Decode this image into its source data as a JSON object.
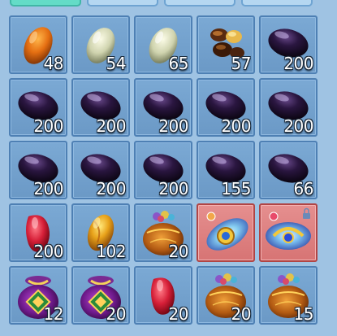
{
  "tabs": [
    {
      "active": true
    },
    {
      "active": false
    },
    {
      "active": false
    },
    {
      "active": false
    }
  ],
  "items": [
    {
      "icon": "orange-egg-icon",
      "qty": "48"
    },
    {
      "icon": "pale-egg-icon",
      "qty": "54"
    },
    {
      "icon": "pale-egg-icon",
      "qty": "65"
    },
    {
      "icon": "seed-pile-icon",
      "qty": "57"
    },
    {
      "icon": "dark-gem-icon",
      "qty": "200"
    },
    {
      "icon": "dark-gem-icon",
      "qty": "200"
    },
    {
      "icon": "dark-gem-icon",
      "qty": "200"
    },
    {
      "icon": "dark-gem-icon",
      "qty": "200"
    },
    {
      "icon": "dark-gem-icon",
      "qty": "200"
    },
    {
      "icon": "dark-gem-icon",
      "qty": "200"
    },
    {
      "icon": "dark-gem-icon",
      "qty": "200"
    },
    {
      "icon": "dark-gem-icon",
      "qty": "200"
    },
    {
      "icon": "dark-gem-icon",
      "qty": "200"
    },
    {
      "icon": "dark-gem-icon",
      "qty": "155"
    },
    {
      "icon": "dark-gem-icon",
      "qty": "66"
    },
    {
      "icon": "red-gem-icon",
      "qty": "200"
    },
    {
      "icon": "gold-egg-icon",
      "qty": "102"
    },
    {
      "icon": "treasure-bag-icon",
      "qty": "20"
    },
    {
      "icon": "blue-amulet-icon",
      "qty": "",
      "featured": true
    },
    {
      "icon": "blue-amulet-lock-icon",
      "qty": "",
      "featured": true
    },
    {
      "icon": "purple-bag-icon",
      "qty": "12"
    },
    {
      "icon": "purple-bag-icon",
      "qty": "20"
    },
    {
      "icon": "red-gem-icon",
      "qty": "20"
    },
    {
      "icon": "treasure-bag-icon",
      "qty": "20"
    },
    {
      "icon": "treasure-bag-icon",
      "qty": "15"
    }
  ],
  "colors": {
    "background": "#9fc3e3",
    "slot": "#6b99c6",
    "featured_slot": "#d77474",
    "active_tab": "#64dcc7"
  }
}
